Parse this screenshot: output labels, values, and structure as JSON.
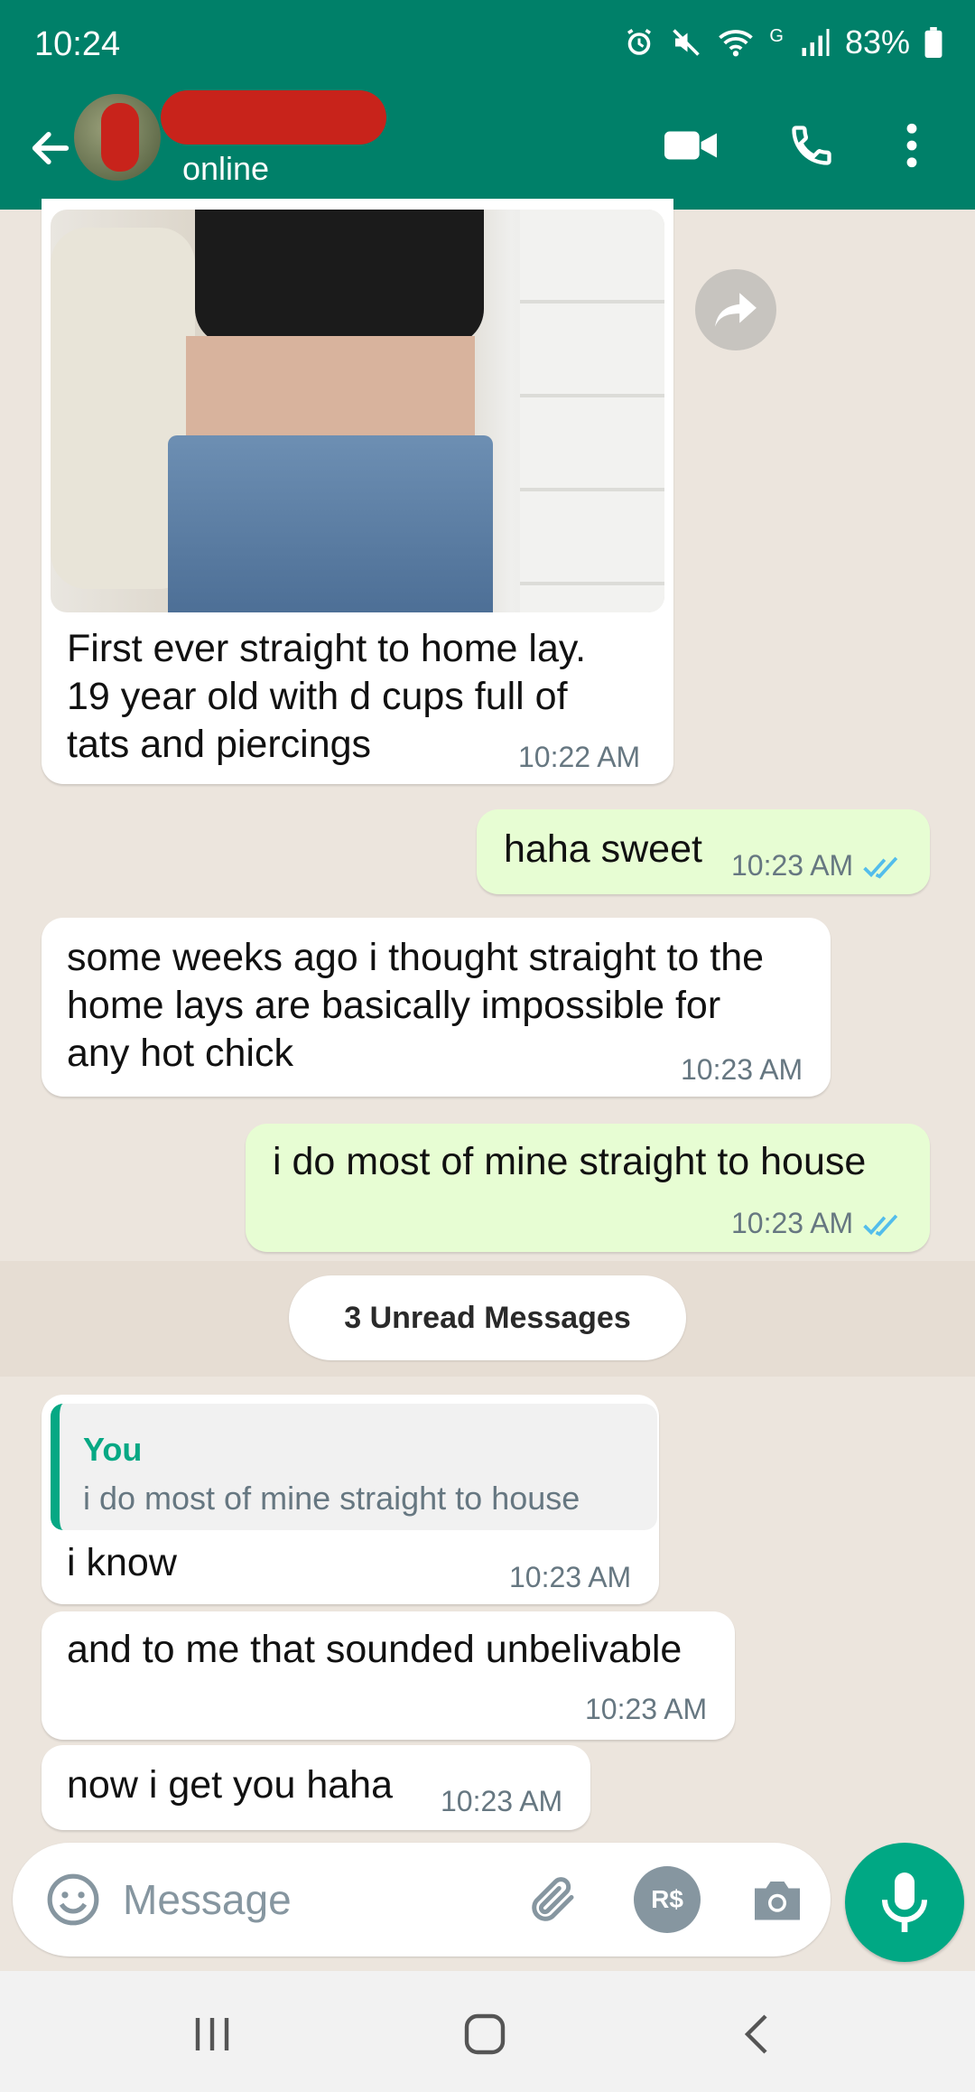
{
  "status_bar": {
    "time": "10:24",
    "network": "G",
    "battery": "83%"
  },
  "header": {
    "contact_status": "online"
  },
  "messages": [
    {
      "direction": "in",
      "text_lines": [
        "First ever straight to home lay.",
        "19 year old with d cups full of",
        "tats and piercings"
      ],
      "time": "10:22 AM",
      "has_photo": true
    },
    {
      "direction": "out",
      "text": "haha sweet",
      "time": "10:23 AM",
      "read": true
    },
    {
      "direction": "in",
      "text_lines": [
        "some weeks ago i thought straight to the",
        "home lays are basically impossible for",
        "any hot chick"
      ],
      "time": "10:23 AM"
    },
    {
      "direction": "out",
      "text": "i do most of mine straight to house",
      "time": "10:23 AM",
      "read": true
    },
    {
      "direction": "in",
      "quote": {
        "author": "You",
        "text": "i do most of mine straight to house"
      },
      "text": "i know",
      "time": "10:23 AM"
    },
    {
      "direction": "in",
      "text": "and to me that sounded unbelivable",
      "time": "10:23 AM"
    },
    {
      "direction": "in",
      "text": "now i get you haha",
      "time": "10:23 AM"
    }
  ],
  "unread_label": "3 Unread Messages",
  "composer": {
    "placeholder": "Message",
    "pay_label": "R$"
  },
  "colors": {
    "header": "#008069",
    "outgoing": "#e7fdd3",
    "incoming": "#ffffff",
    "accent": "#00a884",
    "read_ticks": "#53bdeb"
  },
  "icons": [
    "back-arrow-icon",
    "video-call-icon",
    "phone-icon",
    "more-vert-icon",
    "forward-icon",
    "emoji-icon",
    "attach-icon",
    "camera-icon",
    "mic-icon",
    "read-ticks-icon"
  ]
}
